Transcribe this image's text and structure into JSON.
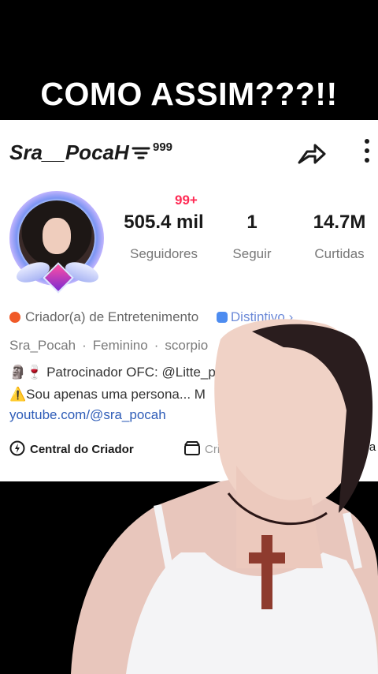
{
  "caption": "COMO ASSIM???!!",
  "profile": {
    "username": "Sra__PocaH",
    "rank": "999",
    "notification_badge": "99+",
    "stats": [
      {
        "value": "505.4 mil",
        "label": "Seguidores"
      },
      {
        "value": "1",
        "label": "Seguir"
      },
      {
        "value": "14.7M",
        "label": "Curtidas"
      }
    ],
    "category": "Criador(a) de Entretenimento",
    "distinctive": "Distintivo",
    "handle": "Sra_Pocah",
    "gender": "Feminino",
    "sign": "scorpio",
    "bio_line1": "Patrocinador OFC: @Litte_p",
    "bio_line2": "Sou apenas uma persona... M",
    "link": "youtube.com/@sra_pocah",
    "actions": [
      "Central do Criador",
      "Cri",
      "Kwa"
    ]
  },
  "colors": {
    "accent_red": "#ff2b55",
    "link_blue": "#2f5db8",
    "category_orange": "#f05a28"
  }
}
